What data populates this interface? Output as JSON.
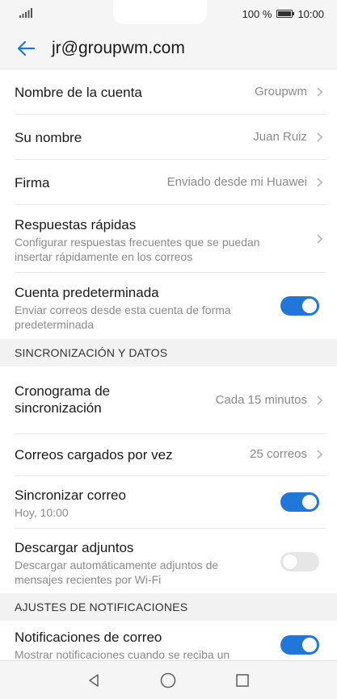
{
  "status_bar": {
    "battery_percent": "100 %",
    "time": "10:00",
    "signal_icon": "signal-icon",
    "battery_icon": "battery-icon"
  },
  "header": {
    "title": "jr@groupwm.com",
    "back_icon": "arrow-left-icon"
  },
  "account_settings": [
    {
      "label": "Nombre de la cuenta",
      "value": "Groupwm"
    },
    {
      "label": "Su nombre",
      "value": "Juan Ruiz"
    },
    {
      "label": "Firma",
      "value": "Enviado desde mi Huawei"
    },
    {
      "label": "Respuestas rápidas",
      "sub_line1": "Configurar respuestas frecuentes que se puedan",
      "sub_line2": "insertar rápidamente en los correos"
    },
    {
      "label": "Cuenta predeterminada",
      "sub_line1": "Enviar correos desde esta cuenta de forma",
      "sub_line2": "predeterminada",
      "toggle": true
    }
  ],
  "sync_section": {
    "title": "SINCRONIZACIÓN Y DATOS",
    "items": [
      {
        "label_line1": "Cronograma de",
        "label_line2": "sincronización",
        "value": "Cada 15 minutos"
      },
      {
        "label": "Correos cargados por vez",
        "value": "25 correos"
      },
      {
        "label": "Sincronizar correo",
        "sub": "Hoy, 10:00",
        "toggle": true
      },
      {
        "label": "Descargar adjuntos",
        "sub_line1": "Descargar automáticamente adjuntos de",
        "sub_line2": "mensajes recientes por Wi-Fi",
        "toggle": false
      }
    ]
  },
  "notifications_section": {
    "title": "AJUSTES DE NOTIFICACIONES",
    "items": [
      {
        "label": "Notificaciones de correo",
        "sub": "Mostrar notificaciones cuando se reciba un",
        "toggle": true
      }
    ]
  },
  "colors": {
    "accent": "#2176d9",
    "toggle_off": "#e6e6e6",
    "secondary_text": "#8a8a8a"
  },
  "navbar": {
    "back_icon": "triangle-back-icon",
    "home_icon": "circle-home-icon",
    "recents_icon": "square-recents-icon"
  }
}
